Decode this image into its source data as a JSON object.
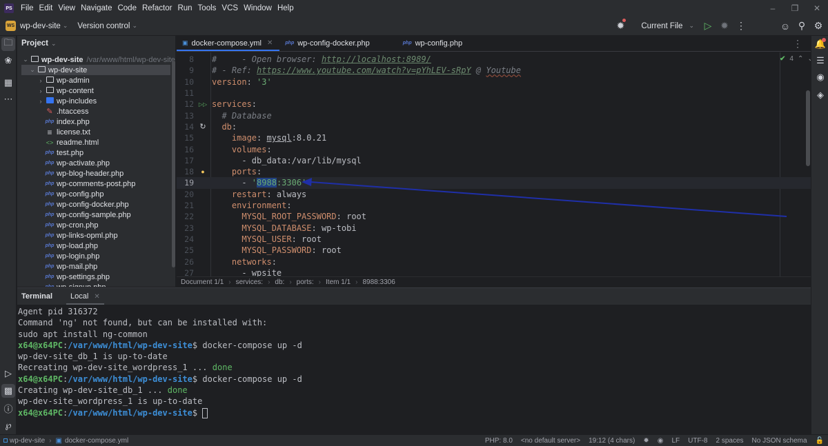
{
  "menubar": {
    "app_logo": "PS",
    "items": [
      "File",
      "Edit",
      "View",
      "Navigate",
      "Code",
      "Refactor",
      "Run",
      "Tools",
      "VCS",
      "Window",
      "Help"
    ],
    "window_controls": [
      "minimize-icon",
      "restore-icon",
      "close-icon"
    ]
  },
  "toolbar": {
    "project_badge": "WS",
    "project_name": "wp-dev-site",
    "version_control": "Version control",
    "run_config": "Current File",
    "icons": [
      "debug-bug-icon",
      "run-icon",
      "debug-icon",
      "more-vertical-icon",
      "add-user-icon",
      "search-icon",
      "settings-icon"
    ]
  },
  "left_strip": {
    "icons": [
      "project-folder-icon",
      "services-icon",
      "structure-icon",
      "more-icon",
      "run-services-icon",
      "terminal-icon",
      "problems-icon",
      "git-icon"
    ]
  },
  "right_strip": {
    "icons": [
      "notifications-icon",
      "database-icon",
      "copilot-icon",
      "ai-chat-icon"
    ]
  },
  "project": {
    "title": "Project",
    "root": {
      "name": "wp-dev-site",
      "path": "/var/www/html/wp-dev-site"
    },
    "items": [
      {
        "name": "wp-dev-site",
        "type": "folder",
        "level": 1,
        "expanded": true,
        "selected": true
      },
      {
        "name": "wp-admin",
        "type": "folder",
        "level": 2,
        "expanded": false
      },
      {
        "name": "wp-content",
        "type": "folder",
        "level": 2,
        "expanded": false
      },
      {
        "name": "wp-includes",
        "type": "folder-blue",
        "level": 2,
        "expanded": false
      },
      {
        "name": ".htaccess",
        "type": "htaccess",
        "level": 2
      },
      {
        "name": "index.php",
        "type": "php",
        "level": 2
      },
      {
        "name": "license.txt",
        "type": "txt",
        "level": 2
      },
      {
        "name": "readme.html",
        "type": "html",
        "level": 2
      },
      {
        "name": "test.php",
        "type": "php",
        "level": 2
      },
      {
        "name": "wp-activate.php",
        "type": "php",
        "level": 2
      },
      {
        "name": "wp-blog-header.php",
        "type": "php",
        "level": 2
      },
      {
        "name": "wp-comments-post.php",
        "type": "php",
        "level": 2
      },
      {
        "name": "wp-config.php",
        "type": "php",
        "level": 2
      },
      {
        "name": "wp-config-docker.php",
        "type": "php",
        "level": 2
      },
      {
        "name": "wp-config-sample.php",
        "type": "php",
        "level": 2
      },
      {
        "name": "wp-cron.php",
        "type": "php",
        "level": 2
      },
      {
        "name": "wp-links-opml.php",
        "type": "php",
        "level": 2
      },
      {
        "name": "wp-load.php",
        "type": "php",
        "level": 2
      },
      {
        "name": "wp-login.php",
        "type": "php",
        "level": 2
      },
      {
        "name": "wp-mail.php",
        "type": "php",
        "level": 2
      },
      {
        "name": "wp-settings.php",
        "type": "php",
        "level": 2
      },
      {
        "name": "wp-signup.php",
        "type": "php",
        "level": 2
      }
    ]
  },
  "editor": {
    "tabs": [
      {
        "label": "docker-compose.yml",
        "icon": "docker-icon",
        "active": true
      },
      {
        "label": "wp-config-docker.php",
        "icon": "php-icon",
        "active": false
      },
      {
        "label": "wp-config.php",
        "icon": "php-icon",
        "active": false
      }
    ],
    "inspection_count": "4",
    "current_line": 19,
    "lines": [
      {
        "n": 8,
        "segments": [
          {
            "t": "#     - Open browser: ",
            "c": "comment"
          },
          {
            "t": "http://localhost:8989/",
            "c": "link"
          }
        ]
      },
      {
        "n": 9,
        "segments": [
          {
            "t": "# - Ref: ",
            "c": "comment"
          },
          {
            "t": "https://www.youtube.com/watch?v=pYhLEV-sRpY",
            "c": "link"
          },
          {
            "t": " @ ",
            "c": "comment"
          },
          {
            "t": "Youtube",
            "c": "comment-spell"
          }
        ]
      },
      {
        "n": 10,
        "segments": [
          {
            "t": "version",
            "c": "key"
          },
          {
            "t": ": ",
            "c": "plain"
          },
          {
            "t": "'3'",
            "c": "str"
          }
        ]
      },
      {
        "n": 11,
        "segments": []
      },
      {
        "n": 12,
        "gutter": "run-icon",
        "segments": [
          {
            "t": "services",
            "c": "key"
          },
          {
            "t": ":",
            "c": "plain"
          }
        ]
      },
      {
        "n": 13,
        "segments": [
          {
            "t": "  # Database",
            "c": "comment"
          }
        ]
      },
      {
        "n": 14,
        "gutter": "reload-icon",
        "segments": [
          {
            "t": "  ",
            "c": "plain"
          },
          {
            "t": "db",
            "c": "key"
          },
          {
            "t": ":",
            "c": "plain"
          }
        ]
      },
      {
        "n": 15,
        "segments": [
          {
            "t": "    ",
            "c": "plain"
          },
          {
            "t": "image",
            "c": "key"
          },
          {
            "t": ": ",
            "c": "plain"
          },
          {
            "t": "mysql",
            "c": "ul"
          },
          {
            "t": ":8.0.21",
            "c": "plain"
          }
        ]
      },
      {
        "n": 16,
        "segments": [
          {
            "t": "    ",
            "c": "plain"
          },
          {
            "t": "volumes",
            "c": "key"
          },
          {
            "t": ":",
            "c": "plain"
          }
        ]
      },
      {
        "n": 17,
        "segments": [
          {
            "t": "      - db_data:/var/lib/mysql",
            "c": "plain"
          }
        ]
      },
      {
        "n": 18,
        "gutter": "bulb-icon",
        "segments": [
          {
            "t": "    ",
            "c": "plain"
          },
          {
            "t": "ports",
            "c": "key"
          },
          {
            "t": ":",
            "c": "plain"
          }
        ]
      },
      {
        "n": 19,
        "segments": [
          {
            "t": "      - ",
            "c": "plain"
          },
          {
            "t": "'",
            "c": "str"
          },
          {
            "t": "8988",
            "c": "str-sel"
          },
          {
            "t": ":3306'",
            "c": "str"
          }
        ]
      },
      {
        "n": 20,
        "segments": [
          {
            "t": "    ",
            "c": "plain"
          },
          {
            "t": "restart",
            "c": "key"
          },
          {
            "t": ": always",
            "c": "plain"
          }
        ]
      },
      {
        "n": 21,
        "segments": [
          {
            "t": "    ",
            "c": "plain"
          },
          {
            "t": "environment",
            "c": "key"
          },
          {
            "t": ":",
            "c": "plain"
          }
        ]
      },
      {
        "n": 22,
        "segments": [
          {
            "t": "      ",
            "c": "plain"
          },
          {
            "t": "MYSQL_ROOT_PASSWORD",
            "c": "key"
          },
          {
            "t": ": root",
            "c": "plain"
          }
        ]
      },
      {
        "n": 23,
        "segments": [
          {
            "t": "      ",
            "c": "plain"
          },
          {
            "t": "MYSQL_DATABASE",
            "c": "key"
          },
          {
            "t": ": wp-tobi",
            "c": "plain"
          }
        ]
      },
      {
        "n": 24,
        "segments": [
          {
            "t": "      ",
            "c": "plain"
          },
          {
            "t": "MYSQL_USER",
            "c": "key"
          },
          {
            "t": ": root",
            "c": "plain"
          }
        ]
      },
      {
        "n": 25,
        "segments": [
          {
            "t": "      ",
            "c": "plain"
          },
          {
            "t": "MYSQL_PASSWORD",
            "c": "key"
          },
          {
            "t": ": root",
            "c": "plain"
          }
        ]
      },
      {
        "n": 26,
        "segments": [
          {
            "t": "    ",
            "c": "plain"
          },
          {
            "t": "networks",
            "c": "key"
          },
          {
            "t": ":",
            "c": "plain"
          }
        ]
      },
      {
        "n": 27,
        "segments": [
          {
            "t": "      - ",
            "c": "plain"
          },
          {
            "t": "wpsite",
            "c": "dotted"
          }
        ]
      }
    ],
    "breadcrumbs": [
      "Document 1/1",
      "services:",
      "db:",
      "ports:",
      "Item 1/1",
      "8988:3306"
    ]
  },
  "terminal": {
    "title": "Terminal",
    "tab": "Local",
    "lines": [
      [
        {
          "t": "Agent pid 316372",
          "c": "plain"
        }
      ],
      [
        {
          "t": "Command 'ng' not found, but can be installed with:",
          "c": "plain"
        }
      ],
      [
        {
          "t": "sudo apt install ng-common",
          "c": "plain"
        }
      ],
      [
        {
          "t": "x64@x64PC",
          "c": "user"
        },
        {
          "t": ":",
          "c": "plain"
        },
        {
          "t": "/var/www/html/wp-dev-site",
          "c": "path"
        },
        {
          "t": "$ docker-compose up -d",
          "c": "plain"
        }
      ],
      [
        {
          "t": "wp-dev-site_db_1 is up-to-date",
          "c": "plain"
        }
      ],
      [
        {
          "t": "Recreating wp-dev-site_wordpress_1 ... ",
          "c": "plain"
        },
        {
          "t": "done",
          "c": "done"
        }
      ],
      [
        {
          "t": "x64@x64PC",
          "c": "user"
        },
        {
          "t": ":",
          "c": "plain"
        },
        {
          "t": "/var/www/html/wp-dev-site",
          "c": "path"
        },
        {
          "t": "$ docker-compose up -d",
          "c": "plain"
        }
      ],
      [
        {
          "t": "Creating wp-dev-site_db_1 ... ",
          "c": "plain"
        },
        {
          "t": "done",
          "c": "done"
        }
      ],
      [
        {
          "t": "wp-dev-site_wordpress_1 is up-to-date",
          "c": "plain"
        }
      ],
      [
        {
          "t": "x64@x64PC",
          "c": "user"
        },
        {
          "t": ":",
          "c": "plain"
        },
        {
          "t": "/var/www/html/wp-dev-site",
          "c": "path"
        },
        {
          "t": "$ ",
          "c": "plain"
        },
        {
          "t": "",
          "c": "cursor"
        }
      ]
    ]
  },
  "statusbar": {
    "project": "wp-dev-site",
    "file": "docker-compose.yml",
    "php_version": "PHP: 8.0",
    "server": "<no default server>",
    "position": "19:12 (4 chars)",
    "line_ending": "LF",
    "encoding": "UTF-8",
    "indent": "2 spaces",
    "schema": "No JSON schema"
  }
}
